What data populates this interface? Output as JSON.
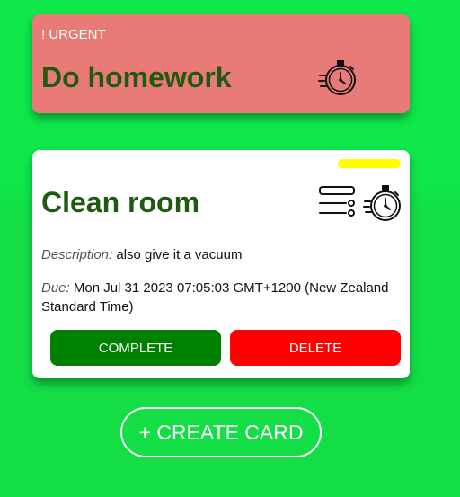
{
  "colors": {
    "background": "#0ee84a",
    "urgent_card": "#e87b78",
    "title_text": "#1f5a12",
    "priority_bar": "#ffff00",
    "complete_button": "#008000",
    "delete_button": "#ff0000"
  },
  "cards": [
    {
      "urgent_label": "! URGENT",
      "title": "Do homework",
      "icons": [
        "stopwatch-icon"
      ]
    },
    {
      "title": "Clean room",
      "icons": [
        "list-icon",
        "stopwatch-icon"
      ],
      "description_label": "Description:",
      "description": "also give it a vacuum",
      "due_label": "Due:",
      "due": "Mon Jul 31 2023 07:05:03 GMT+1200 (New Zealand Standard Time)",
      "complete_label": "COMPLETE",
      "delete_label": "DELETE"
    }
  ],
  "create_card_label": "+ CREATE CARD"
}
